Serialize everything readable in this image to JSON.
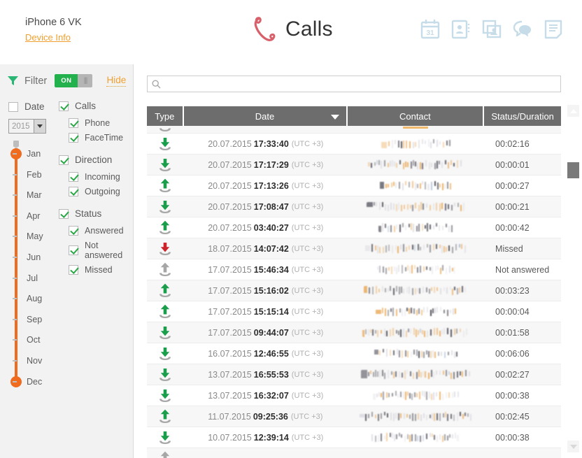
{
  "header": {
    "device_name": "iPhone 6 VK",
    "device_info_link": "Device Info",
    "page_title": "Calls",
    "phone_icon": "phone-handset-icon",
    "icons": [
      {
        "name": "calendar-icon",
        "label": "31"
      },
      {
        "name": "contacts-icon",
        "label": ""
      },
      {
        "name": "photos-icon",
        "label": ""
      },
      {
        "name": "messages-icon",
        "label": ""
      },
      {
        "name": "notes-icon",
        "label": ""
      }
    ]
  },
  "sidebar": {
    "filter_label": "Filter",
    "toggle_state": "ON",
    "hide_label": "Hide",
    "date_label": "Date",
    "date_checked": false,
    "year_value": "2015",
    "months": [
      "Jan",
      "Feb",
      "Mar",
      "Apr",
      "May",
      "Jun",
      "Jul",
      "Aug",
      "Sep",
      "Oct",
      "Nov",
      "Dec"
    ],
    "range_start": "Jan",
    "range_end": "Dec",
    "groups": [
      {
        "label": "Calls",
        "checked": true,
        "items": [
          {
            "label": "Phone",
            "checked": true
          },
          {
            "label": "FaceTime",
            "checked": true
          }
        ]
      },
      {
        "label": "Direction",
        "checked": true,
        "items": [
          {
            "label": "Incoming",
            "checked": true
          },
          {
            "label": "Outgoing",
            "checked": true
          }
        ]
      },
      {
        "label": "Status",
        "checked": true,
        "items": [
          {
            "label": "Answered",
            "checked": true
          },
          {
            "label": "Not answered",
            "checked": true
          },
          {
            "label": "Missed",
            "checked": true
          }
        ]
      }
    ]
  },
  "main": {
    "search": {
      "value": "",
      "placeholder": ""
    },
    "columns": [
      {
        "key": "type",
        "label": "Type"
      },
      {
        "key": "date",
        "label": "Date",
        "sorted": "desc"
      },
      {
        "key": "contact",
        "label": "Contact"
      },
      {
        "key": "status",
        "label": "Status/Duration"
      }
    ],
    "timezone": "(UTC +3)",
    "rows": [
      {
        "type": "incoming-answered",
        "date": "20.07.2015",
        "time": "17:33:40",
        "tz": "(UTC +3)",
        "contact": "",
        "status": "00:02:16"
      },
      {
        "type": "incoming-answered",
        "date": "20.07.2015",
        "time": "17:17:29",
        "tz": "(UTC +3)",
        "contact": "",
        "status": "00:00:01"
      },
      {
        "type": "outgoing-answered",
        "date": "20.07.2015",
        "time": "17:13:26",
        "tz": "(UTC +3)",
        "contact": "",
        "status": "00:00:27"
      },
      {
        "type": "incoming-answered",
        "date": "20.07.2015",
        "time": "17:08:47",
        "tz": "(UTC +3)",
        "contact": "",
        "status": "00:00:21"
      },
      {
        "type": "outgoing-answered",
        "date": "20.07.2015",
        "time": "03:40:27",
        "tz": "(UTC +3)",
        "contact": "",
        "status": "00:00:42"
      },
      {
        "type": "missed",
        "date": "18.07.2015",
        "time": "14:07:42",
        "tz": "(UTC +3)",
        "contact": "",
        "status": "Missed"
      },
      {
        "type": "not-answered",
        "date": "17.07.2015",
        "time": "15:46:34",
        "tz": "(UTC +3)",
        "contact": "",
        "status": "Not answered"
      },
      {
        "type": "outgoing-answered",
        "date": "17.07.2015",
        "time": "15:16:02",
        "tz": "(UTC +3)",
        "contact": "",
        "status": "00:03:23"
      },
      {
        "type": "outgoing-answered",
        "date": "17.07.2015",
        "time": "15:15:14",
        "tz": "(UTC +3)",
        "contact": "",
        "status": "00:00:04"
      },
      {
        "type": "incoming-answered",
        "date": "17.07.2015",
        "time": "09:44:07",
        "tz": "(UTC +3)",
        "contact": "",
        "status": "00:01:58"
      },
      {
        "type": "incoming-answered",
        "date": "16.07.2015",
        "time": "12:46:55",
        "tz": "(UTC +3)",
        "contact": "",
        "status": "00:06:06"
      },
      {
        "type": "incoming-answered",
        "date": "13.07.2015",
        "time": "16:55:53",
        "tz": "(UTC +3)",
        "contact": "",
        "status": "00:02:27"
      },
      {
        "type": "incoming-answered",
        "date": "13.07.2015",
        "time": "16:32:07",
        "tz": "(UTC +3)",
        "contact": "",
        "status": "00:00:38"
      },
      {
        "type": "outgoing-answered",
        "date": "11.07.2015",
        "time": "09:25:36",
        "tz": "(UTC +3)",
        "contact": "",
        "status": "00:02:45"
      },
      {
        "type": "incoming-answered",
        "date": "10.07.2015",
        "time": "12:39:14",
        "tz": "(UTC +3)",
        "contact": "",
        "status": "00:00:38"
      }
    ]
  },
  "colors": {
    "accent_orange": "#f0a030",
    "slider_orange": "#ef6c1f",
    "green": "#22b14c",
    "red": "#cc2229",
    "gray": "#9a9a9a",
    "header_gray": "#6d6d6d",
    "sidebar_bg": "#f2f2f2",
    "icon_blue": "#c6dce8"
  }
}
